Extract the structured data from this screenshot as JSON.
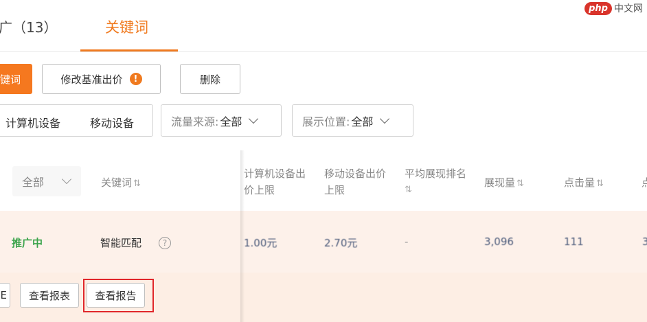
{
  "tabs": {
    "prev_label": "广（13）",
    "active_label": "关键词"
  },
  "watermark": {
    "logo": "php",
    "text": "中文网"
  },
  "toolbar": {
    "add_keyword_label": "键词",
    "modify_bid_label": "修改基准出价",
    "warning_mark": "!",
    "delete_label": "删除"
  },
  "filters": {
    "device_options": [
      "计算机设备",
      "移动设备"
    ],
    "traffic_source": {
      "label": "流量来源:",
      "value": "全部"
    },
    "display_position": {
      "label": "展示位置:",
      "value": "全部"
    }
  },
  "table": {
    "status_filter": "全部",
    "headers": {
      "keyword": "关键词",
      "pc_bid": [
        "计算机设备出",
        "价上限"
      ],
      "mobile_bid": [
        "移动设备出价",
        "上限"
      ],
      "avg_rank": [
        "平均展现排名"
      ],
      "impressions": "展现量",
      "clicks": "点击量",
      "cut": "点"
    },
    "sort_glyph": "⇅",
    "row": {
      "status": "推广中",
      "match_type": "智能匹配",
      "help": "?",
      "pc_bid": "1.00元",
      "mobile_bid": "2.70元",
      "avg_rank": "-",
      "impressions": "3,096",
      "clicks": "111",
      "cut": "3"
    },
    "actions": {
      "cut_left": "E",
      "view_table": "查看报表",
      "view_report": "查看报告"
    }
  }
}
